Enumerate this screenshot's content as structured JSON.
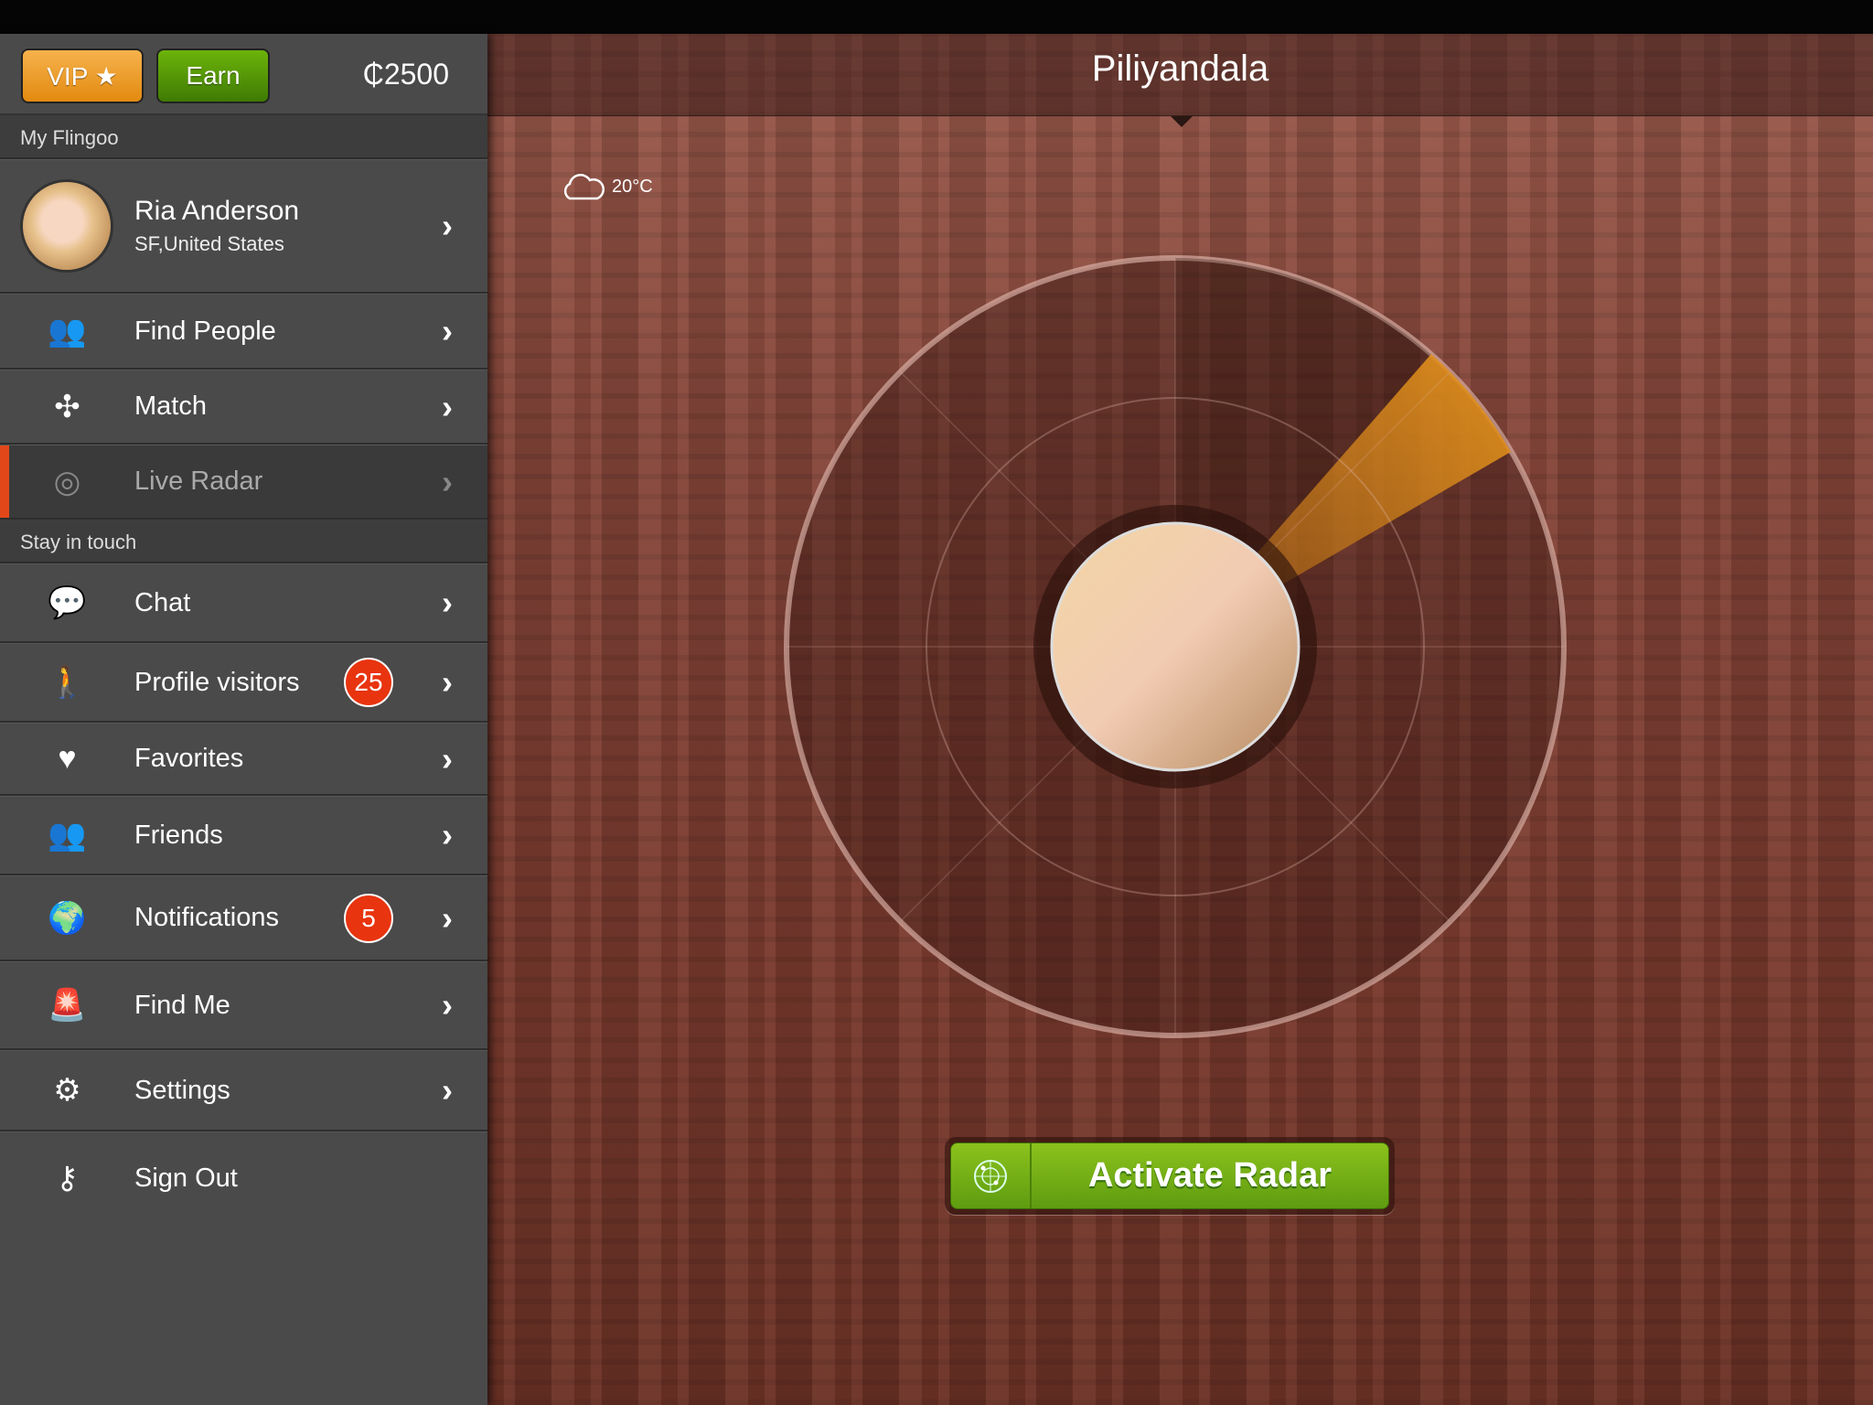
{
  "sidebar": {
    "vip_label": "VIP ★",
    "earn_label": "Earn",
    "coins": "₵2500",
    "section_my": "My Flingoo",
    "profile": {
      "name": "Ria Anderson",
      "location": "SF,United States"
    },
    "items_top": [
      {
        "label": "Find People",
        "icon": "find-people-icon"
      },
      {
        "label": "Match",
        "icon": "puzzle-icon"
      },
      {
        "label": "Live Radar",
        "icon": "radar-icon",
        "selected": true
      }
    ],
    "section_touch": "Stay in touch",
    "items": [
      {
        "label": "Chat",
        "icon": "chat-bubble-icon"
      },
      {
        "label": "Profile visitors",
        "icon": "walking-person-icon",
        "badge": "25"
      },
      {
        "label": "Favorites",
        "icon": "heart-icon"
      },
      {
        "label": "Friends",
        "icon": "friends-icon"
      },
      {
        "label": "Notifications",
        "icon": "globe-icon",
        "badge": "5"
      },
      {
        "label": "Find Me",
        "icon": "siren-icon"
      },
      {
        "label": "Settings",
        "icon": "gear-icon"
      },
      {
        "label": "Sign Out",
        "icon": "key-icon"
      }
    ]
  },
  "main": {
    "title": "Piliyandala",
    "weather": {
      "icon": "cloud-icon",
      "temp": "20°C"
    },
    "activate_label": "Activate Radar"
  },
  "colors": {
    "accent": "#e2471a",
    "vip": "#f0a030",
    "earn": "#5a9e08",
    "badge": "#e8340f",
    "radar_sweep": "#e08a1a"
  }
}
